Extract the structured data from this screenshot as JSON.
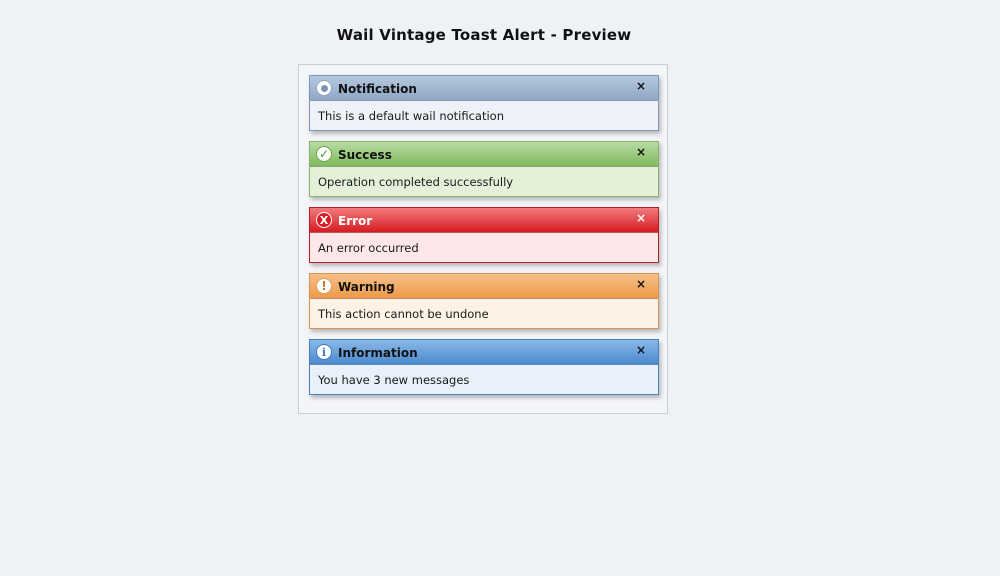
{
  "page": {
    "title": "Wail Vintage Toast Alert - Preview"
  },
  "toasts": [
    {
      "type": "notification",
      "title": "Notification",
      "message": "This is a default wail notification",
      "close_label": "×",
      "icon": "dot-icon",
      "color": "#8ea7c6"
    },
    {
      "type": "success",
      "title": "Success",
      "message": "Operation completed successfully",
      "close_label": "×",
      "icon_glyph": "✓",
      "icon": "check-icon",
      "color": "#7fba5e"
    },
    {
      "type": "error",
      "title": "Error",
      "message": "An error occurred",
      "close_label": "×",
      "icon_glyph": "X",
      "icon": "error-icon",
      "color": "#d51d22"
    },
    {
      "type": "warning",
      "title": "Warning",
      "message": "This action cannot be undone",
      "close_label": "×",
      "icon_glyph": "!",
      "icon": "warning-icon",
      "color": "#ec9a48"
    },
    {
      "type": "information",
      "title": "Information",
      "message": "You have 3 new messages",
      "close_label": "×",
      "icon_glyph": "i",
      "icon": "info-icon",
      "color": "#4a8ad0"
    }
  ]
}
